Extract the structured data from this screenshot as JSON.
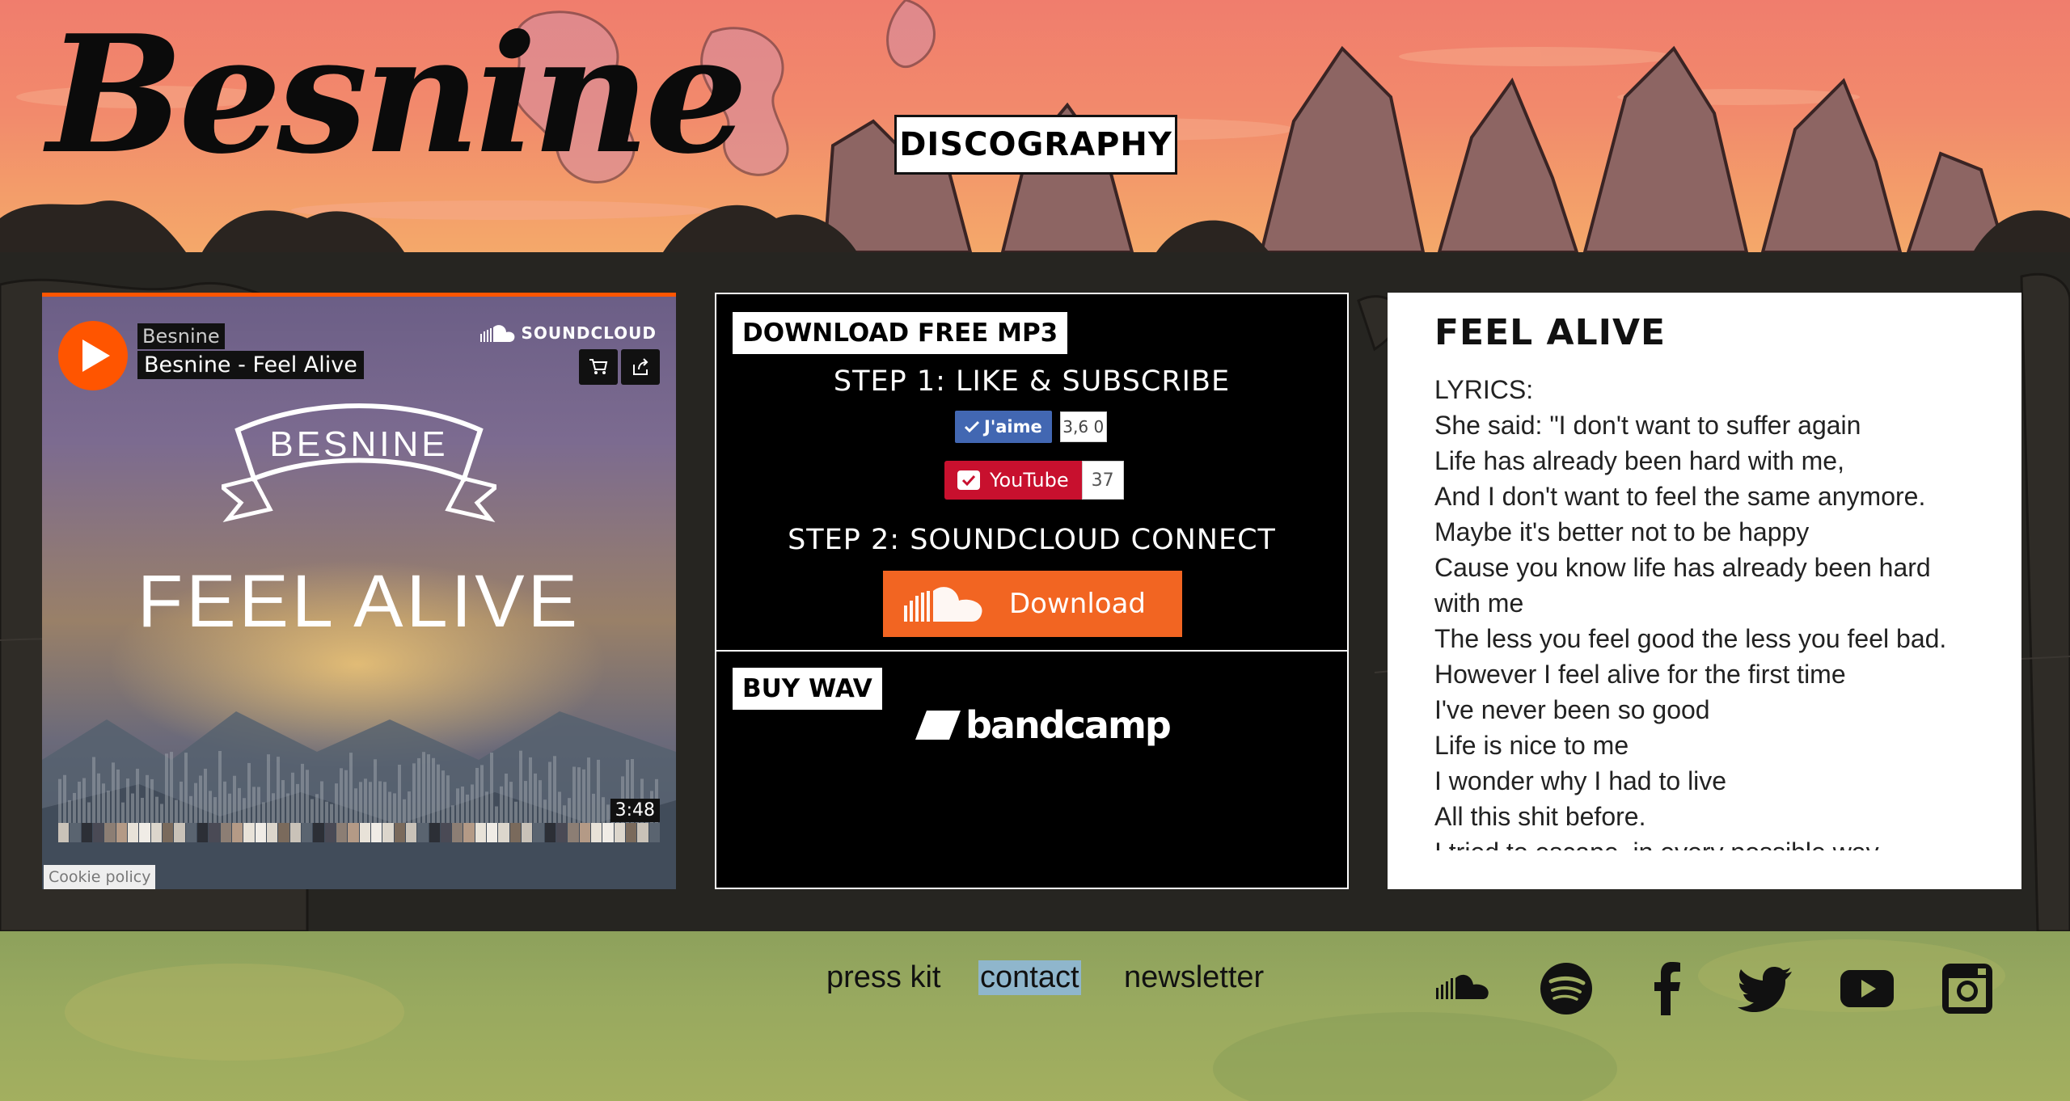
{
  "header": {
    "logo": "Besnine",
    "nav_discography": "DISCOGRAPHY"
  },
  "player": {
    "artist": "Besnine",
    "track": "Besnine - Feel Alive",
    "brand": "SOUNDCLOUD",
    "cover_banner": "BESNINE",
    "cover_title": "FEEL ALIVE",
    "duration": "3:48",
    "cookie_policy": "Cookie policy",
    "accent_color": "#ff5500"
  },
  "download": {
    "heading": "DOWNLOAD FREE MP3",
    "step1": "STEP 1: LIKE & SUBSCRIBE",
    "fb_like_label": "J'aime",
    "fb_like_count": "3,6 0",
    "youtube_label": "YouTube",
    "youtube_count": "37",
    "step2": "STEP 2: SOUNDCLOUD CONNECT",
    "download_label": "Download",
    "buy_heading": "BUY WAV",
    "bandcamp_label": "bandcamp"
  },
  "lyrics": {
    "title": "FEEL ALIVE",
    "lines": [
      "LYRICS:",
      "She said: \"I don't want to suffer again",
      "Life has already been hard with me,",
      "And I don't want to feel the same anymore.",
      "Maybe it's better not to be happy",
      "Cause you know life has already been hard",
      "with me",
      "The less you feel good the less you feel bad.",
      "However I feel alive for the first time",
      "I've never been so good",
      "Life is nice to me",
      "I wonder why I had to live",
      "All this shit before.",
      "I tried to escape, in every possible way"
    ]
  },
  "footer": {
    "links": [
      {
        "label": "press kit"
      },
      {
        "label": "contact",
        "active": true
      },
      {
        "label": "newsletter"
      }
    ],
    "social_icons": [
      "soundcloud-icon",
      "spotify-icon",
      "facebook-icon",
      "twitter-icon",
      "youtube-icon",
      "instagram-icon"
    ]
  }
}
